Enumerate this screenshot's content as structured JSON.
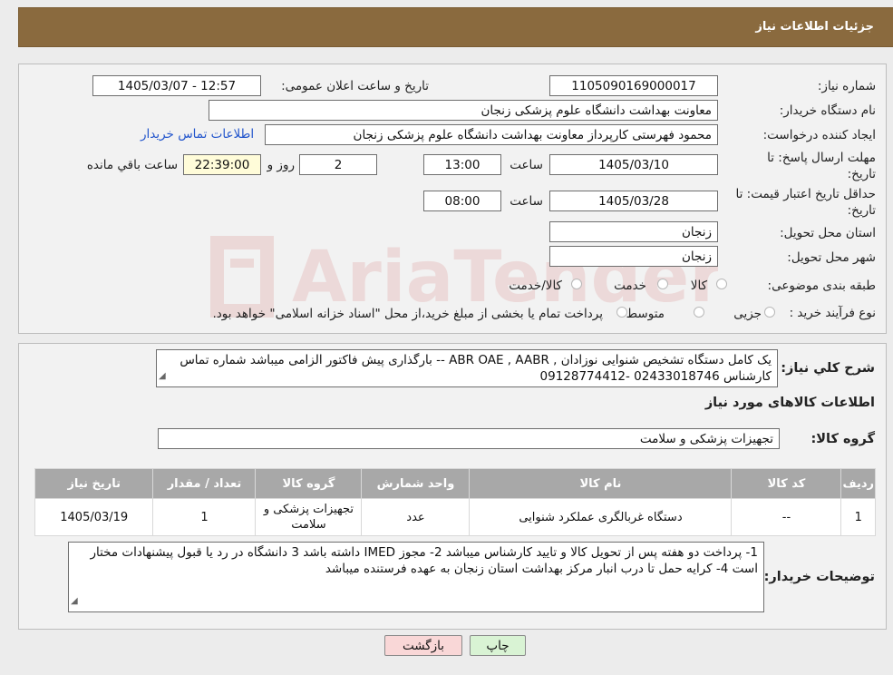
{
  "header": {
    "title": "جزئیات اطلاعات نیاز"
  },
  "form": {
    "need_number_label": "شماره نیاز:",
    "need_number": "1105090169000017",
    "announce_label": "تاریخ و ساعت اعلان عمومی:",
    "announce_value": "1405/03/07 - 12:57",
    "buyer_org_label": "نام دستگاه خریدار:",
    "buyer_org": "معاونت بهداشت دانشگاه علوم پزشکی زنجان",
    "creator_label": "ایجاد کننده درخواست:",
    "creator": "محمود فهرستی کارپرداز معاونت بهداشت دانشگاه علوم پزشکی زنجان",
    "contact_link": "اطلاعات تماس خریدار",
    "deadline_label_1": "مهلت ارسال پاسخ: تا",
    "deadline_label_2": "تاریخ:",
    "deadline_date": "1405/03/10",
    "time_label": "ساعت",
    "deadline_time": "13:00",
    "days": "2",
    "days_label": "روز و",
    "remaining_time": "22:39:00",
    "remaining_label": "ساعت باقي مانده",
    "validity_label_1": "حداقل تاریخ اعتبار قیمت: تا",
    "validity_label_2": "تاریخ:",
    "validity_date": "1405/03/28",
    "validity_time": "08:00",
    "province_label": "استان محل تحویل:",
    "province": "زنجان",
    "city_label": "شهر محل تحویل:",
    "city": "زنجان",
    "category_label": "طبقه بندی موضوعی:",
    "category_options": [
      "کالا",
      "خدمت",
      "کالا/خدمت"
    ],
    "process_label": "نوع فرآیند خرید :",
    "process_options": [
      "جزیی",
      "متوسط"
    ],
    "process_note": "پرداخت تمام یا بخشی از مبلغ خرید،از محل \"اسناد خزانه اسلامی\" خواهد بود."
  },
  "description": {
    "label": "شرح کلي نياز:",
    "text": "یک کامل دستگاه تشخیص شنوایی نوزادان , ABR OAE , AABR -- بارگذاری پیش فاکتور الزامی میباشد شماره تماس کارشناس  02433018746 -09128774412"
  },
  "goods_section": {
    "title": "اطلاعات کالاهای مورد نیاز",
    "group_label": "گروه کالا:",
    "group_value": "تجهیزات پزشکی و سلامت"
  },
  "table": {
    "headers": [
      "ردیف",
      "کد کالا",
      "نام کالا",
      "واحد شمارش",
      "گروه کالا",
      "تعداد / مقدار",
      "تاریخ نیاز"
    ],
    "rows": [
      [
        "1",
        "--",
        "دستگاه غربالگری عملکرد شنوایی",
        "عدد",
        "تجهیزات پزشکی و سلامت",
        "1",
        "1405/03/19"
      ]
    ]
  },
  "buyer_notes": {
    "label": "توضیحات خریدار:",
    "text": "1- پرداخت دو هفته پس از تحویل کالا و تایید کارشناس میباشد 2-  مجوز IMED داشته باشد 3 دانشگاه در رد یا قبول پیشنهادات مختار است 4- کرایه حمل تا درب انبار مرکز بهداشت استان زنجان به عهده فرستنده میباشد"
  },
  "buttons": {
    "print": "چاپ",
    "back": "بازگشت"
  },
  "watermark": {
    "text": "AriaTender.neT"
  },
  "colors": {
    "header": "#8a6a3e",
    "link": "#2255cc",
    "back_button": "#f9d7d7",
    "print_button": "#d9f3d4",
    "table_header": "#a8a8a8"
  }
}
